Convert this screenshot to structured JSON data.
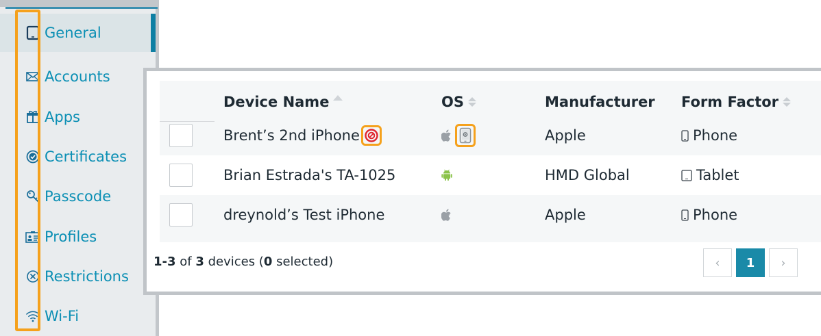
{
  "sidebar": {
    "items": [
      {
        "label": "General",
        "icon": "tablet-icon",
        "active": true
      },
      {
        "label": "Accounts",
        "icon": "envelope-icon"
      },
      {
        "label": "Apps",
        "icon": "package-icon"
      },
      {
        "label": "Certificates",
        "icon": "certificate-icon"
      },
      {
        "label": "Passcode",
        "icon": "key-icon"
      },
      {
        "label": "Profiles",
        "icon": "id-card-icon"
      },
      {
        "label": "Restrictions",
        "icon": "circle-x-icon"
      },
      {
        "label": "Wi-Fi",
        "icon": "wifi-icon"
      }
    ]
  },
  "table": {
    "columns": [
      "Device Name",
      "OS",
      "Manufacturer",
      "Form Factor"
    ],
    "rows": [
      {
        "name": "Brent’s 2nd iPhone",
        "os": "apple",
        "manufacturer": "Apple",
        "form_factor": "Phone",
        "flags": [
          "compass-badge-icon",
          "supervised-device-icon"
        ]
      },
      {
        "name": "Brian Estrada's TA-1025",
        "os": "android",
        "manufacturer": "HMD Global",
        "form_factor": "Tablet"
      },
      {
        "name": "dreynold’s Test iPhone",
        "os": "apple",
        "manufacturer": "Apple",
        "form_factor": "Phone"
      }
    ]
  },
  "footer": {
    "range": "1-3",
    "of_word": " of ",
    "total": "3",
    "devices_word": " devices (",
    "selected": "0",
    "selected_word": " selected)"
  },
  "pagination": {
    "prev": "‹",
    "current": "1",
    "next": "›"
  },
  "colors": {
    "accent": "#0b8fb4",
    "highlight": "#f5a11c",
    "badge_red": "#e0262f",
    "android": "#8bc34a",
    "apple": "#9aa0a6"
  }
}
